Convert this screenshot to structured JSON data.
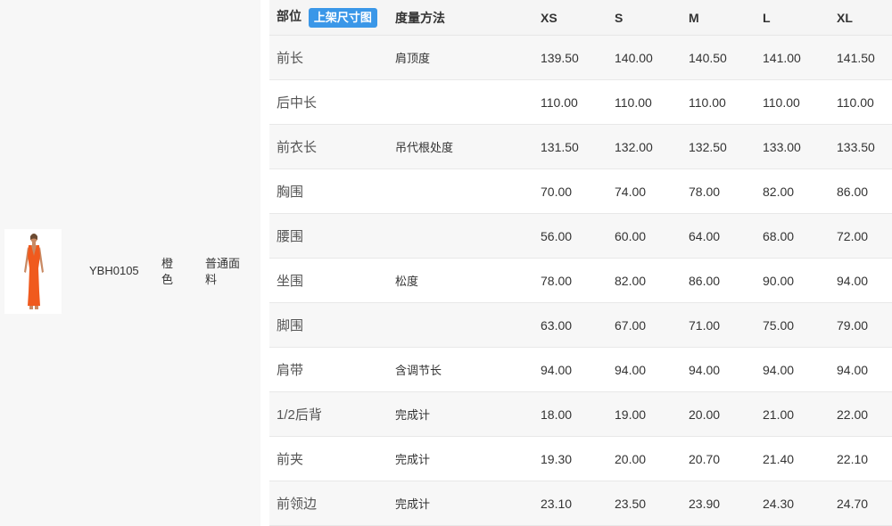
{
  "product": {
    "sku": "YBH0105",
    "color": "橙色",
    "fabric": "普通面料",
    "image_desc_color": "#f05a1e"
  },
  "table": {
    "header": {
      "part": "部位",
      "upload_button": "上架尺寸图",
      "method": "度量方法",
      "sizes": [
        "XS",
        "S",
        "M",
        "L",
        "XL"
      ]
    },
    "rows": [
      {
        "part": "前长",
        "method": "肩顶度",
        "values": [
          "139.50",
          "140.00",
          "140.50",
          "141.00",
          "141.50"
        ]
      },
      {
        "part": "后中长",
        "method": "",
        "values": [
          "110.00",
          "110.00",
          "110.00",
          "110.00",
          "110.00"
        ]
      },
      {
        "part": "前衣长",
        "method": "吊代根处度",
        "values": [
          "131.50",
          "132.00",
          "132.50",
          "133.00",
          "133.50"
        ]
      },
      {
        "part": "胸围",
        "method": "",
        "values": [
          "70.00",
          "74.00",
          "78.00",
          "82.00",
          "86.00"
        ]
      },
      {
        "part": "腰围",
        "method": "",
        "values": [
          "56.00",
          "60.00",
          "64.00",
          "68.00",
          "72.00"
        ]
      },
      {
        "part": "坐围",
        "method": "松度",
        "values": [
          "78.00",
          "82.00",
          "86.00",
          "90.00",
          "94.00"
        ]
      },
      {
        "part": "脚围",
        "method": "",
        "values": [
          "63.00",
          "67.00",
          "71.00",
          "75.00",
          "79.00"
        ]
      },
      {
        "part": "肩带",
        "method": "含调节长",
        "values": [
          "94.00",
          "94.00",
          "94.00",
          "94.00",
          "94.00"
        ]
      },
      {
        "part": "1/2后背",
        "method": "完成计",
        "values": [
          "18.00",
          "19.00",
          "20.00",
          "21.00",
          "22.00"
        ]
      },
      {
        "part": "前夹",
        "method": "完成计",
        "values": [
          "19.30",
          "20.00",
          "20.70",
          "21.40",
          "22.10"
        ]
      },
      {
        "part": "前领边",
        "method": "完成计",
        "values": [
          "23.10",
          "23.50",
          "23.90",
          "24.30",
          "24.70"
        ]
      }
    ]
  },
  "colors": {
    "accent": "#3a97e8",
    "stripe": "#f7f7f7",
    "panel": "#f7f7f7"
  }
}
